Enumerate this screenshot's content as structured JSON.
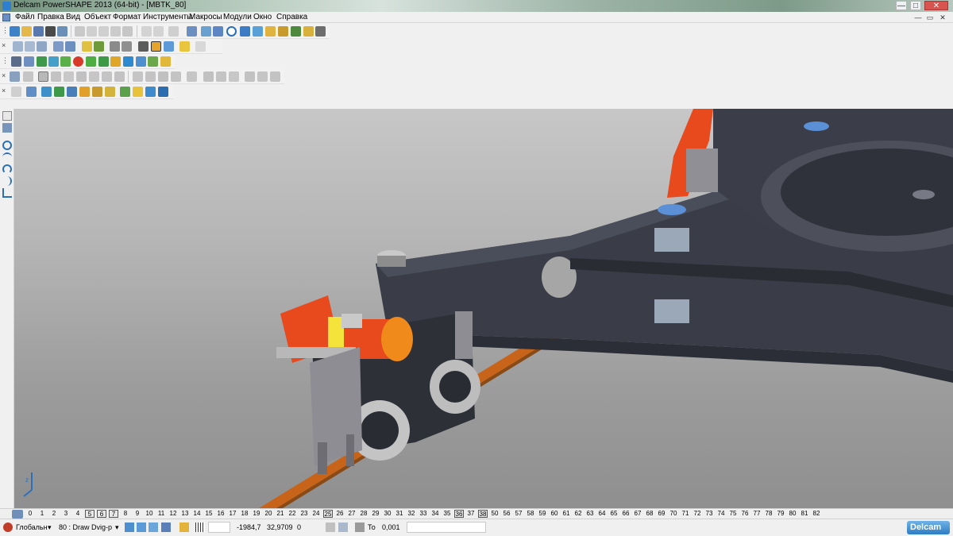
{
  "window": {
    "title": "Delcam PowerSHAPE 2013 (64-bit) - [MBTK_80]",
    "controls": [
      "—",
      "□",
      "✕"
    ]
  },
  "menu": {
    "items": [
      "Файл",
      "Правка",
      "Вид",
      "Объект",
      "Формат",
      "Инструменты",
      "Макросы",
      "Модули",
      "Окно",
      "Справка"
    ],
    "mdi_controls": [
      "—",
      "▭",
      "✕"
    ]
  },
  "toolbars": {
    "row1_icons": [
      "open-icon",
      "new-icon",
      "save-icon",
      "print-icon",
      "cut-icon",
      "copy-icon",
      "paste-icon",
      "undo-icon",
      "redo-icon",
      "select-icon",
      "pick-icon",
      "circle-icon",
      "arc-icon",
      "surface-icon",
      "solid-icon",
      "tools-icon"
    ],
    "row2_icons": [
      "view-top-icon",
      "view-front-icon",
      "view-iso-icon",
      "zoom-in-icon",
      "zoom-out-icon",
      "zoom-fit-icon",
      "shade-icon",
      "wireframe-icon",
      "light-icon",
      "hand-icon"
    ],
    "row3_icons": [
      "grid-icon",
      "file-icon",
      "shape1-icon",
      "shape2-icon",
      "sphere-icon",
      "cone-icon",
      "box-icon",
      "cylinder-icon",
      "torus-icon",
      "flag-icon"
    ],
    "row4_icons": [
      "feature1-icon",
      "feature2-icon",
      "feature3-icon",
      "feature4-icon",
      "feature5-icon",
      "feature6-icon",
      "feature7-icon",
      "feature8-icon"
    ],
    "row5_icons": [
      "wire-icon",
      "curve-icon",
      "solid-add-icon",
      "solid-sub-icon",
      "bolt-icon",
      "pattern-icon",
      "blend-icon",
      "fillet-icon"
    ]
  },
  "left_toolbar": {
    "icons": [
      "select-arrow-icon",
      "filter-icon",
      "point-icon",
      "arc-tool-icon",
      "circle-tool-icon",
      "curve-tool-icon",
      "line-tool-icon"
    ]
  },
  "levels": {
    "numbers": [
      "0",
      "1",
      "2",
      "3",
      "4",
      "5",
      "6",
      "7",
      "8",
      "9",
      "10",
      "11",
      "12",
      "13",
      "14",
      "15",
      "16",
      "17",
      "18",
      "19",
      "20",
      "21",
      "22",
      "23",
      "24",
      "25",
      "26",
      "27",
      "28",
      "29",
      "30",
      "31",
      "32",
      "33",
      "34",
      "35",
      "36",
      "37",
      "38",
      "50",
      "56",
      "57",
      "58",
      "59",
      "60",
      "61",
      "62",
      "63",
      "64",
      "65",
      "66",
      "67",
      "68",
      "69",
      "70",
      "71",
      "72",
      "73",
      "74",
      "75",
      "76",
      "77",
      "78",
      "79",
      "80",
      "81",
      "82"
    ],
    "boxed": [
      "5",
      "6",
      "7",
      "25",
      "36",
      "38"
    ]
  },
  "status": {
    "workplane": "Глобальн",
    "level_select": "80 : Draw Dvig-p",
    "x_coord": "-1984,7",
    "y_coord": "32,9709",
    "z_coord": "0",
    "tolerance_label": "То",
    "tolerance_value": "0,001",
    "brand": "Delcam"
  },
  "colors": {
    "frame": "#3a3d47",
    "rail": "#c8641a",
    "motor_red": "#e84a1e",
    "motor_orange": "#f08a1a",
    "motor_yellow": "#f4e33a",
    "bearing_blue": "#5b8fd6"
  }
}
